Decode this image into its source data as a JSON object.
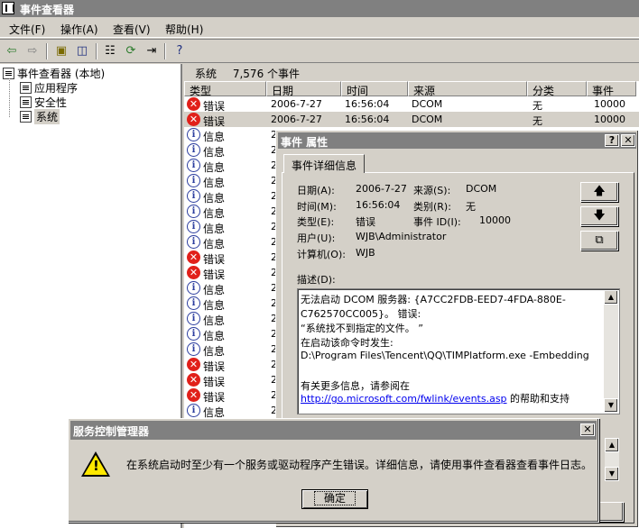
{
  "window": {
    "title": "事件查看器"
  },
  "menu": [
    "文件(F)",
    "操作(A)",
    "查看(V)",
    "帮助(H)"
  ],
  "toolbar": {
    "icons": [
      "back-icon",
      "forward-icon",
      "up-folder-icon",
      "show-hide-tree-icon",
      "properties-icon",
      "refresh-icon",
      "export-icon",
      "help-icon"
    ]
  },
  "tree": {
    "root": "事件查看器 (本地)",
    "items": [
      "应用程序",
      "安全性",
      "系统"
    ]
  },
  "pane": {
    "name": "系统",
    "count": "7,576 个事件"
  },
  "columns": [
    "类型",
    "日期",
    "时间",
    "来源",
    "分类",
    "事件"
  ],
  "rows": [
    {
      "type": "错误",
      "kind": "error",
      "date": "2006-7-27",
      "time": "16:56:04",
      "source": "DCOM",
      "category": "无",
      "event": "10000"
    },
    {
      "type": "错误",
      "kind": "error",
      "date": "2006-7-27",
      "time": "16:56:04",
      "source": "DCOM",
      "category": "无",
      "event": "10000"
    },
    {
      "type": "信息",
      "kind": "info",
      "date": "2"
    },
    {
      "type": "信息",
      "kind": "info",
      "date": "2"
    },
    {
      "type": "信息",
      "kind": "info",
      "date": "2"
    },
    {
      "type": "信息",
      "kind": "info",
      "date": "2"
    },
    {
      "type": "信息",
      "kind": "info",
      "date": "2"
    },
    {
      "type": "信息",
      "kind": "info",
      "date": "2"
    },
    {
      "type": "信息",
      "kind": "info",
      "date": "2"
    },
    {
      "type": "信息",
      "kind": "info",
      "date": "2"
    },
    {
      "type": "错误",
      "kind": "error",
      "date": "2"
    },
    {
      "type": "错误",
      "kind": "error",
      "date": "2"
    },
    {
      "type": "信息",
      "kind": "info",
      "date": "2"
    },
    {
      "type": "信息",
      "kind": "info",
      "date": "2"
    },
    {
      "type": "信息",
      "kind": "info",
      "date": "2"
    },
    {
      "type": "信息",
      "kind": "info",
      "date": "2"
    },
    {
      "type": "信息",
      "kind": "info",
      "date": "2"
    },
    {
      "type": "错误",
      "kind": "error",
      "date": "2"
    },
    {
      "type": "错误",
      "kind": "error",
      "date": "2"
    },
    {
      "type": "错误",
      "kind": "error",
      "date": "2"
    },
    {
      "type": "信息",
      "kind": "info",
      "date": "2"
    }
  ],
  "props": {
    "title": "事件 属性",
    "tab": "事件详细信息",
    "date_label": "日期(A):",
    "date": "2006-7-27",
    "source_label": "来源(S):",
    "source": "DCOM",
    "time_label": "时间(M):",
    "time": "16:56:04",
    "category_label": "类别(R):",
    "category": "无",
    "type_label": "类型(E):",
    "type": "错误",
    "eventid_label": "事件 ID(I):",
    "eventid": "10000",
    "user_label": "用户(U):",
    "user": "WJB\\Administrator",
    "computer_label": "计算机(O):",
    "computer": "WJB",
    "desc_label": "描述(D):",
    "desc_lines": [
      "无法启动 DCOM 服务器: {A7CC2FDB-EED7-4FDA-880E-",
      "C762570CC005}。 错误:",
      "  “系统找不到指定的文件。 ”",
      "  在启动该命令时发生:",
      "D:\\Program Files\\Tencent\\QQ\\TIMPlatform.exe -Embedding",
      "",
      "有关更多信息，请参阅在"
    ],
    "desc_link": "http://go.microsoft.com/fwlink/events.asp",
    "desc_link_suffix": " 的帮助和支持"
  },
  "scm": {
    "title": "服务控制管理器",
    "message": "在系统启动时至少有一个服务或驱动程序产生错误。详细信息，请使用事件查看器查看事件日志。",
    "ok": "确定"
  }
}
